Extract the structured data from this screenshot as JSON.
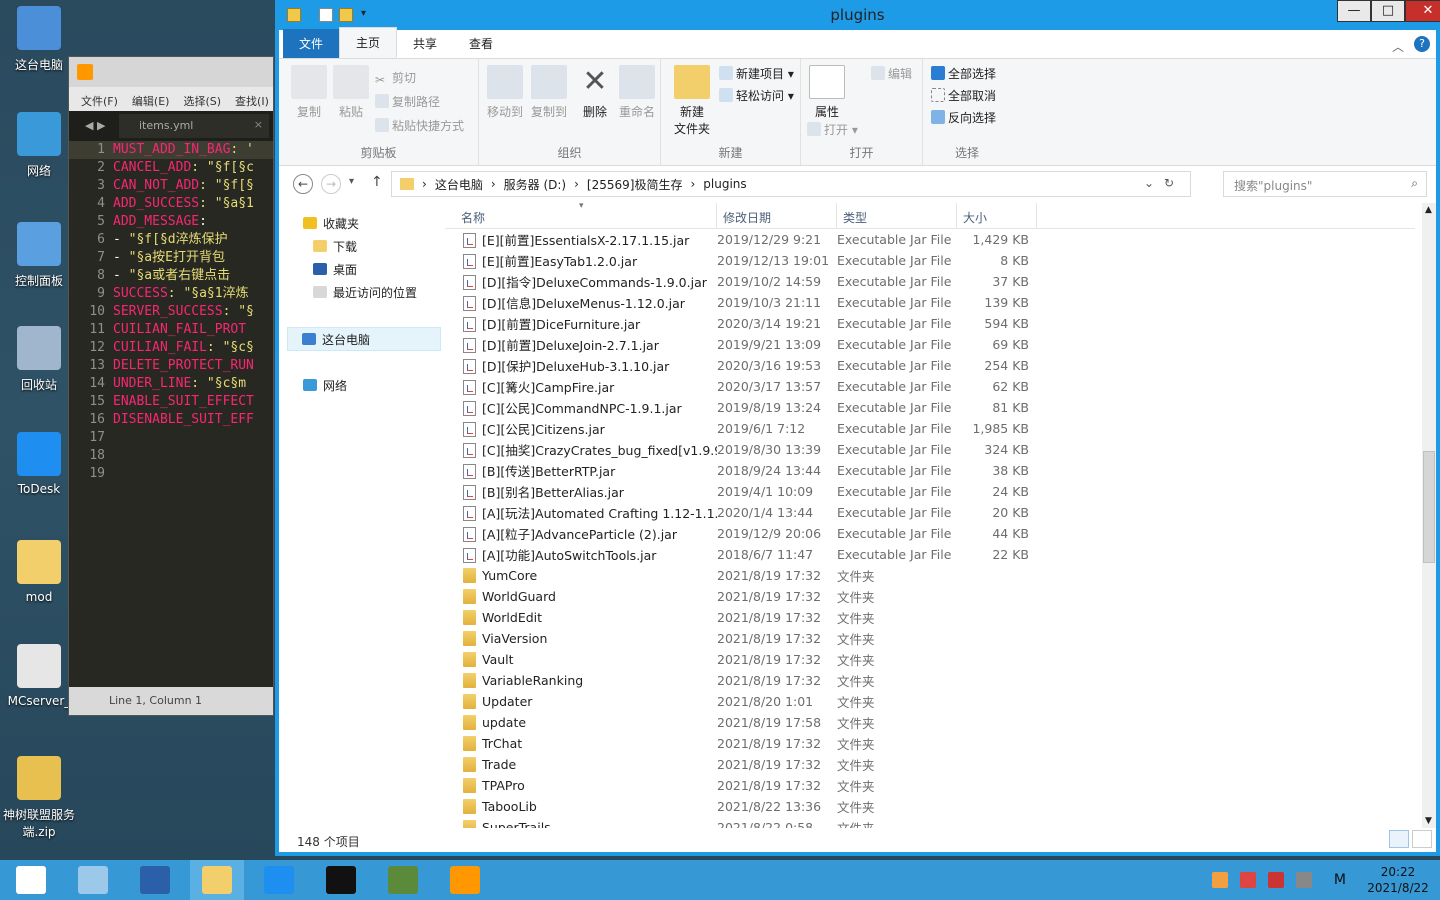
{
  "desktop": {
    "icons": [
      {
        "label": "这台电脑",
        "icon": "computer-icon",
        "color": "#4a8fd8"
      },
      {
        "label": "网络",
        "icon": "network-globe-icon",
        "color": "#3a9ad9"
      },
      {
        "label": "控制面板",
        "icon": "control-panel-icon",
        "color": "#5aa0e0"
      },
      {
        "label": "回收站",
        "icon": "recycle-bin-icon",
        "color": "#9fb6cc"
      },
      {
        "label": "ToDesk",
        "icon": "todesk-icon",
        "color": "#1e8ef0"
      },
      {
        "label": "mod",
        "icon": "folder-icon",
        "color": "#f2cf6a"
      },
      {
        "label": "MCserver_",
        "icon": "shortcut-window-icon",
        "color": "#e6e6e6"
      },
      {
        "label": "神树联盟服务端.zip",
        "icon": "zip-folder-icon",
        "color": "#e8c050"
      }
    ]
  },
  "editor": {
    "menu": [
      "文件(F)",
      "编辑(E)",
      "选择(S)",
      "查找(I)"
    ],
    "tab": "items.yml",
    "status": "Line 1, Column 1",
    "lines": [
      {
        "n": "1",
        "key": "MUST_ADD_IN_BAG",
        "val": ": '"
      },
      {
        "n": "2",
        "key": "CANCEL_ADD",
        "val": ": \"§f[§c"
      },
      {
        "n": "3",
        "key": "CAN_NOT_ADD",
        "val": ": \"§f[§"
      },
      {
        "n": "4",
        "key": "ADD_SUCCESS",
        "val": ": \"§a§1"
      },
      {
        "n": "5",
        "key": "ADD_MESSAGE",
        "val": ":"
      },
      {
        "n": "6",
        "key": "  - ",
        "val": "\"§f[§d淬炼保护"
      },
      {
        "n": "7",
        "key": "  - ",
        "val": "\"§a按E打开背包"
      },
      {
        "n": "8",
        "key": "  - ",
        "val": "\"§a或者右键点击"
      },
      {
        "n": "9",
        "key": "SUCCESS",
        "val": ": \"§a§1淬炼"
      },
      {
        "n": "10",
        "key": "SERVER_SUCCESS",
        "val": ": \"§"
      },
      {
        "n": "11",
        "key": "CUILIAN_FAIL_PROT",
        "val": ""
      },
      {
        "n": "12",
        "key": "CUILIAN_FAIL",
        "val": ": \"§c§"
      },
      {
        "n": "13",
        "key": "DELETE_PROTECT_RUN",
        "val": ""
      },
      {
        "n": "14",
        "key": "UNDER_LINE",
        "val": ": \"§c§m"
      },
      {
        "n": "15",
        "key": "ENABLE_SUIT_EFFECT",
        "val": ""
      },
      {
        "n": "16",
        "key": "DISENABLE_SUIT_EFF",
        "val": ""
      },
      {
        "n": "17",
        "key": "",
        "val": ""
      },
      {
        "n": "18",
        "key": "",
        "val": ""
      },
      {
        "n": "19",
        "key": "",
        "val": ""
      }
    ]
  },
  "explorer": {
    "title": "plugins",
    "tabs": {
      "file": "文件",
      "home": "主页",
      "share": "共享",
      "view": "查看"
    },
    "ribbon": {
      "copy": "复制",
      "paste": "粘贴",
      "cut": "剪切",
      "copy_path": "复制路径",
      "paste_shortcut": "粘贴快捷方式",
      "clipboard": "剪贴板",
      "move_to": "移动到",
      "copy_to": "复制到",
      "delete": "删除",
      "rename": "重命名",
      "organize": "组织",
      "new_folder_1": "新建",
      "new_folder_2": "文件夹",
      "new_item": "新建项目 ▾",
      "easy_access": "轻松访问 ▾",
      "new": "新建",
      "properties": "属性",
      "open": "打开 ▾",
      "edit": "编辑",
      "open_group": "打开",
      "select_all": "全部选择",
      "select_none": "全部取消",
      "invert": "反向选择",
      "select": "选择"
    },
    "address": {
      "parts": [
        "这台电脑",
        "服务器 (D:)",
        "[25569]极简生存",
        "plugins"
      ]
    },
    "search_placeholder": "搜索\"plugins\"",
    "nav": {
      "favorites": "收藏夹",
      "downloads": "下载",
      "desktop": "桌面",
      "recent": "最近访问的位置",
      "this_pc": "这台电脑",
      "network": "网络"
    },
    "columns": {
      "name": "名称",
      "date": "修改日期",
      "type": "类型",
      "size": "大小"
    },
    "files": [
      {
        "name": "[E][前置]EssentialsX-2.17.1.15.jar",
        "date": "2019/12/29 9:21",
        "type": "Executable Jar File",
        "size": "1,429 KB",
        "kind": "jar"
      },
      {
        "name": "[E][前置]EasyTab1.2.0.jar",
        "date": "2019/12/13 19:01",
        "type": "Executable Jar File",
        "size": "8 KB",
        "kind": "jar"
      },
      {
        "name": "[D][指令]DeluxeCommands-1.9.0.jar",
        "date": "2019/10/2 14:59",
        "type": "Executable Jar File",
        "size": "37 KB",
        "kind": "jar"
      },
      {
        "name": "[D][信息]DeluxeMenus-1.12.0.jar",
        "date": "2019/10/3 21:11",
        "type": "Executable Jar File",
        "size": "139 KB",
        "kind": "jar"
      },
      {
        "name": "[D][前置]DiceFurniture.jar",
        "date": "2020/3/14 19:21",
        "type": "Executable Jar File",
        "size": "594 KB",
        "kind": "jar"
      },
      {
        "name": "[D][前置]DeluxeJoin-2.7.1.jar",
        "date": "2019/9/21 13:09",
        "type": "Executable Jar File",
        "size": "69 KB",
        "kind": "jar"
      },
      {
        "name": "[D][保护]DeluxeHub-3.1.10.jar",
        "date": "2020/3/16 19:53",
        "type": "Executable Jar File",
        "size": "254 KB",
        "kind": "jar"
      },
      {
        "name": "[C][篝火]CampFire.jar",
        "date": "2020/3/17 13:57",
        "type": "Executable Jar File",
        "size": "62 KB",
        "kind": "jar"
      },
      {
        "name": "[C][公民]CommandNPC-1.9.1.jar",
        "date": "2019/8/19 13:24",
        "type": "Executable Jar File",
        "size": "81 KB",
        "kind": "jar"
      },
      {
        "name": "[C][公民]Citizens.jar",
        "date": "2019/6/1 7:12",
        "type": "Executable Jar File",
        "size": "1,985 KB",
        "kind": "jar"
      },
      {
        "name": "[C][抽奖]CrazyCrates_bug_fixed[v1.9.9...",
        "date": "2019/8/30 13:39",
        "type": "Executable Jar File",
        "size": "324 KB",
        "kind": "jar"
      },
      {
        "name": "[B][传送]BetterRTP.jar",
        "date": "2018/9/24 13:44",
        "type": "Executable Jar File",
        "size": "38 KB",
        "kind": "jar"
      },
      {
        "name": "[B][别名]BetterAlias.jar",
        "date": "2019/4/1 10:09",
        "type": "Executable Jar File",
        "size": "24 KB",
        "kind": "jar"
      },
      {
        "name": "[A][玩法]Automated Crafting 1.12-1.1...",
        "date": "2020/1/4 13:44",
        "type": "Executable Jar File",
        "size": "20 KB",
        "kind": "jar"
      },
      {
        "name": "[A][粒子]AdvanceParticle (2).jar",
        "date": "2019/12/9 20:06",
        "type": "Executable Jar File",
        "size": "44 KB",
        "kind": "jar"
      },
      {
        "name": "[A][功能]AutoSwitchTools.jar",
        "date": "2018/6/7 11:47",
        "type": "Executable Jar File",
        "size": "22 KB",
        "kind": "jar"
      },
      {
        "name": "YumCore",
        "date": "2021/8/19 17:32",
        "type": "文件夹",
        "size": "",
        "kind": "folder"
      },
      {
        "name": "WorldGuard",
        "date": "2021/8/19 17:32",
        "type": "文件夹",
        "size": "",
        "kind": "folder"
      },
      {
        "name": "WorldEdit",
        "date": "2021/8/19 17:32",
        "type": "文件夹",
        "size": "",
        "kind": "folder"
      },
      {
        "name": "ViaVersion",
        "date": "2021/8/19 17:32",
        "type": "文件夹",
        "size": "",
        "kind": "folder"
      },
      {
        "name": "Vault",
        "date": "2021/8/19 17:32",
        "type": "文件夹",
        "size": "",
        "kind": "folder"
      },
      {
        "name": "VariableRanking",
        "date": "2021/8/19 17:32",
        "type": "文件夹",
        "size": "",
        "kind": "folder"
      },
      {
        "name": "Updater",
        "date": "2021/8/20 1:01",
        "type": "文件夹",
        "size": "",
        "kind": "folder"
      },
      {
        "name": "update",
        "date": "2021/8/19 17:58",
        "type": "文件夹",
        "size": "",
        "kind": "folder"
      },
      {
        "name": "TrChat",
        "date": "2021/8/19 17:32",
        "type": "文件夹",
        "size": "",
        "kind": "folder"
      },
      {
        "name": "Trade",
        "date": "2021/8/19 17:32",
        "type": "文件夹",
        "size": "",
        "kind": "folder"
      },
      {
        "name": "TPAPro",
        "date": "2021/8/19 17:32",
        "type": "文件夹",
        "size": "",
        "kind": "folder"
      },
      {
        "name": "TabooLib",
        "date": "2021/8/22 13:36",
        "type": "文件夹",
        "size": "",
        "kind": "folder"
      },
      {
        "name": "SuperTrails",
        "date": "2021/8/22 0:58",
        "type": "文件夹",
        "size": "",
        "kind": "folder"
      }
    ],
    "item_count": "148 个项目"
  },
  "taskbar": {
    "apps": [
      {
        "icon": "start-windows-icon",
        "color": "#ffffff"
      },
      {
        "icon": "server-manager-icon",
        "color": "#9cc8ea"
      },
      {
        "icon": "powershell-icon",
        "color": "#2b5fa8"
      },
      {
        "icon": "file-explorer-icon",
        "color": "#f2cf6a"
      },
      {
        "icon": "todesk-taskbar-icon",
        "color": "#1e8ef0"
      },
      {
        "icon": "command-prompt-icon",
        "color": "#111111"
      },
      {
        "icon": "minecraft-icon",
        "color": "#5a8a3a"
      },
      {
        "icon": "sublime-text-icon",
        "color": "#ff9800"
      }
    ],
    "ime": "M",
    "time": "20:22",
    "date": "2021/8/22"
  }
}
